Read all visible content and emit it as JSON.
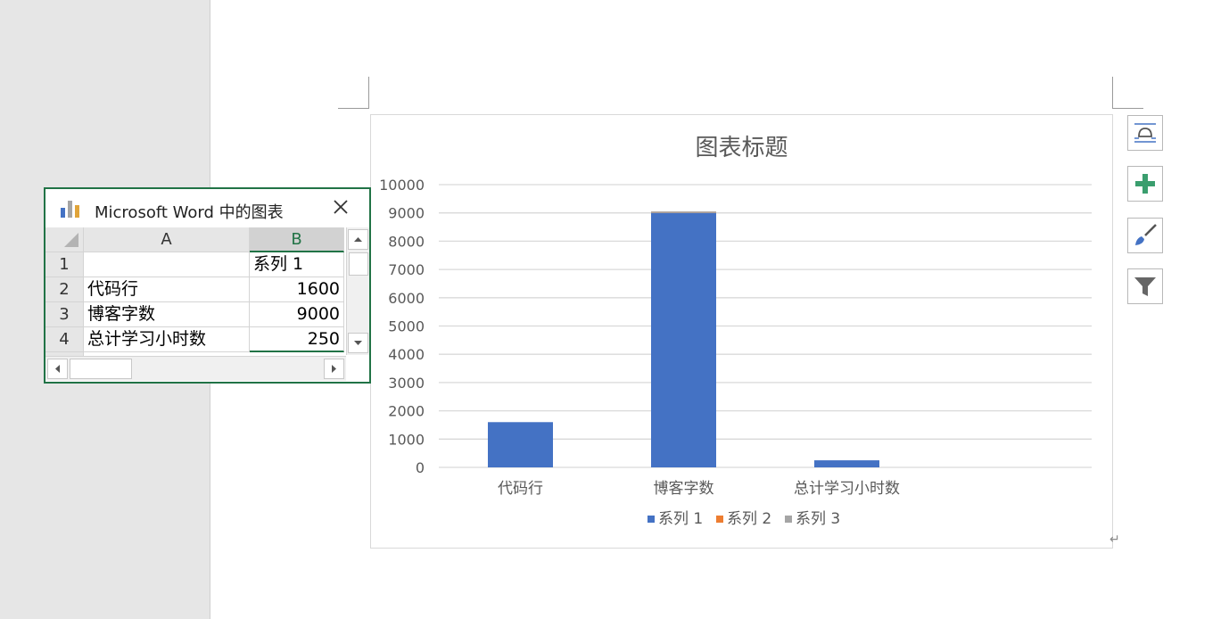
{
  "chart_data": {
    "type": "bar",
    "title": "图表标题",
    "categories": [
      "代码行",
      "博客字数",
      "总计学习小时数"
    ],
    "series": [
      {
        "name": "系列 1",
        "values": [
          1600,
          9000,
          250
        ],
        "color": "#4472c4"
      },
      {
        "name": "系列 2",
        "values": [
          0,
          0,
          0
        ],
        "color": "#ed7d31"
      },
      {
        "name": "系列 3",
        "values": [
          0,
          0,
          0
        ],
        "color": "#a5a5a5"
      }
    ],
    "ylim": [
      0,
      10000
    ],
    "yticks": [
      "10000",
      "9000",
      "8000",
      "7000",
      "6000",
      "5000",
      "4000",
      "3000",
      "2000",
      "1000",
      "0"
    ],
    "grid": true,
    "legend_position": "bottom"
  },
  "sheet": {
    "title": "Microsoft Word 中的图表",
    "columns": [
      "A",
      "B"
    ],
    "rows": [
      {
        "num": "1",
        "a": "",
        "b": "系列 1"
      },
      {
        "num": "2",
        "a": "代码行",
        "b": "1600"
      },
      {
        "num": "3",
        "a": "博客字数",
        "b": "9000"
      },
      {
        "num": "4",
        "a": "总计学习小时数",
        "b": "250"
      }
    ]
  },
  "side_buttons": [
    {
      "name": "layout-options-icon"
    },
    {
      "name": "chart-elements-icon"
    },
    {
      "name": "chart-styles-icon"
    },
    {
      "name": "chart-filters-icon"
    }
  ],
  "colors": {
    "accent_green": "#217346",
    "bar_blue": "#4472c4"
  }
}
